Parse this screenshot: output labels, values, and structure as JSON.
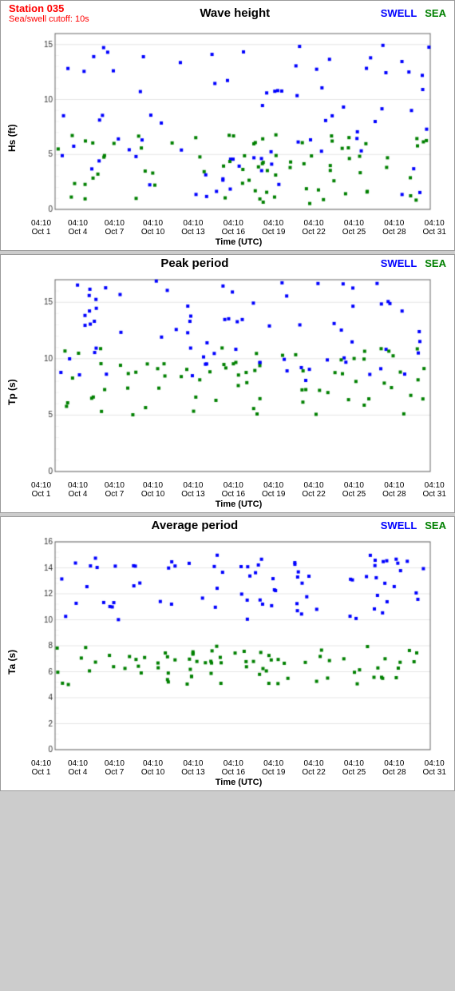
{
  "station": {
    "id": "Station 035",
    "cutoff": "Sea/swell cutoff: 10s"
  },
  "charts": [
    {
      "title": "Wave height",
      "yLabel": "Hs (ft)",
      "yMin": 0,
      "yMax": 16,
      "yTicks": [
        0,
        5,
        10,
        15
      ],
      "xLabels": [
        "04:10\nOct 1",
        "04:10\nOct 4",
        "04:10\nOct 7",
        "04:10\nOct 10",
        "04:10\nOct 13",
        "04:10\nOct 16",
        "04:10\nOct 19",
        "04:10\nOct 22",
        "04:10\nOct 25",
        "04:10\nOct 28",
        "04:10\nOct 31"
      ],
      "xAxisLabel": "Time (UTC)",
      "legendSwell": "SWELL",
      "legendSea": "SEA"
    },
    {
      "title": "Peak period",
      "yLabel": "Tp (s)",
      "yMin": 0,
      "yMax": 17,
      "yTicks": [
        0,
        5,
        10,
        15
      ],
      "xLabels": [
        "04:10\nOct 1",
        "04:10\nOct 4",
        "04:10\nOct 7",
        "04:10\nOct 10",
        "04:10\nOct 13",
        "04:10\nOct 16",
        "04:10\nOct 19",
        "04:10\nOct 22",
        "04:10\nOct 25",
        "04:10\nOct 28",
        "04:10\nOct 31"
      ],
      "xAxisLabel": "Time (UTC)",
      "legendSwell": "SWELL",
      "legendSea": "SEA"
    },
    {
      "title": "Average period",
      "yLabel": "Ta (s)",
      "yMin": 0,
      "yMax": 16,
      "yTicks": [
        0,
        2,
        4,
        6,
        8,
        10,
        12,
        14,
        16
      ],
      "xLabels": [
        "04:10\nOct 1",
        "04:10\nOct 4",
        "04:10\nOct 7",
        "04:10\nOct 10",
        "04:10\nOct 13",
        "04:10\nOct 16",
        "04:10\nOct 19",
        "04:10\nOct 22",
        "04:10\nOct 25",
        "04:10\nOct 28",
        "04:10\nOct 31"
      ],
      "xAxisLabel": "Time (UTC)",
      "legendSwell": "SWELL",
      "legendSea": "SEA"
    }
  ]
}
